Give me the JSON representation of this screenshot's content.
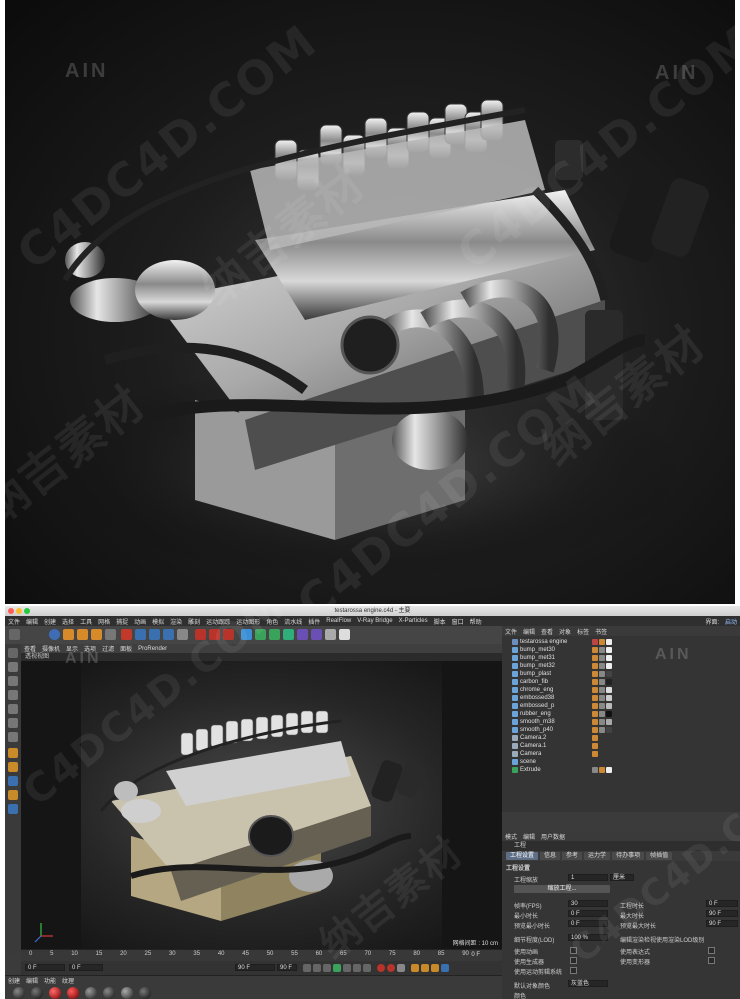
{
  "window": {
    "title": "testarossa engine.c4d - 主要"
  },
  "watermark": {
    "brand": "C4DC4D.COM",
    "cn": "纳吉素材",
    "ain": "AIN"
  },
  "menubar": {
    "left": [
      "文件",
      "编辑",
      "创建",
      "选择",
      "工具",
      "网格",
      "捕捉",
      "动画",
      "模拟",
      "渲染",
      "雕刻",
      "运动跟踪",
      "运动图形",
      "角色",
      "流水线",
      "插件",
      "RealFlow",
      "V-Ray Bridge",
      "X-Particles",
      "脚本",
      "窗口",
      "帮助"
    ],
    "right": [
      "界面:",
      "启动"
    ]
  },
  "viewport": {
    "menu": [
      "查看",
      "摄像机",
      "显示",
      "选项",
      "过滤",
      "面板",
      "ProRender"
    ],
    "label": "透视视图",
    "grid": "网格间距 : 10 cm"
  },
  "timeline": {
    "ticks": [
      "0",
      "5",
      "10",
      "15",
      "20",
      "25",
      "30",
      "35",
      "40",
      "45",
      "50",
      "55",
      "60",
      "65",
      "70",
      "75",
      "80",
      "85",
      "90"
    ],
    "current": "0 F"
  },
  "transport": {
    "start": "0 F",
    "field2": "0 F",
    "end": "90 F",
    "end2": "90 F"
  },
  "materials": {
    "menu": [
      "创建",
      "编辑",
      "功能",
      "纹理"
    ]
  },
  "objects": {
    "tabs": [
      "文件",
      "编辑",
      "查看",
      "对象",
      "标签",
      "书签"
    ],
    "rows": [
      {
        "name": "testarossa engine"
      },
      {
        "name": "bump_met30"
      },
      {
        "name": "bump_met31"
      },
      {
        "name": "bump_met32"
      },
      {
        "name": "bump_plast"
      },
      {
        "name": "carbon_fib"
      },
      {
        "name": "chrome_eng"
      },
      {
        "name": "embossed38"
      },
      {
        "name": "embossed_p"
      },
      {
        "name": "rubber_eng"
      },
      {
        "name": "smooth_m38"
      },
      {
        "name": "smooth_p40"
      },
      {
        "name": "Camera.2"
      },
      {
        "name": "Camera.1"
      },
      {
        "name": "Camera"
      },
      {
        "name": "scene"
      },
      {
        "name": "Extrude"
      }
    ]
  },
  "attributes": {
    "tabs": [
      "模式",
      "编辑",
      "用户数据"
    ],
    "title": "工程",
    "subtabs": [
      "工程设置",
      "信息",
      "参考",
      "运力学",
      "待办事项",
      "帧插值"
    ],
    "section": "工程设置",
    "scale_label": "工程缩放",
    "scale_value": "1",
    "scale_unit": "厘米",
    "scale_button": "缩放工程...",
    "fields": [
      {
        "label": "帧率(FPS)",
        "value": "30",
        "label2": "工程时长",
        "value2": "0 F"
      },
      {
        "label": "最小时长",
        "value": "0 F",
        "label2": "最大时长",
        "value2": "90 F"
      },
      {
        "label": "预览最小时长",
        "value": "0 F",
        "label2": "预览最大时长",
        "value2": "90 F"
      }
    ],
    "lod_label": "细节程度(LOD)",
    "lod_value": "100 %",
    "lod_label2": "编辑渲染检视使用渲染LOD级别",
    "checks": [
      {
        "label": "使用动画",
        "label2": "使用表达式"
      },
      {
        "label": "使用生成器",
        "label2": "使用变形器"
      },
      {
        "label": "使用运动剪辑系统",
        "label2": ""
      }
    ],
    "default_color_label": "默认对象颜色",
    "default_color_value": "灰蓝色",
    "color_label": "颜色"
  }
}
